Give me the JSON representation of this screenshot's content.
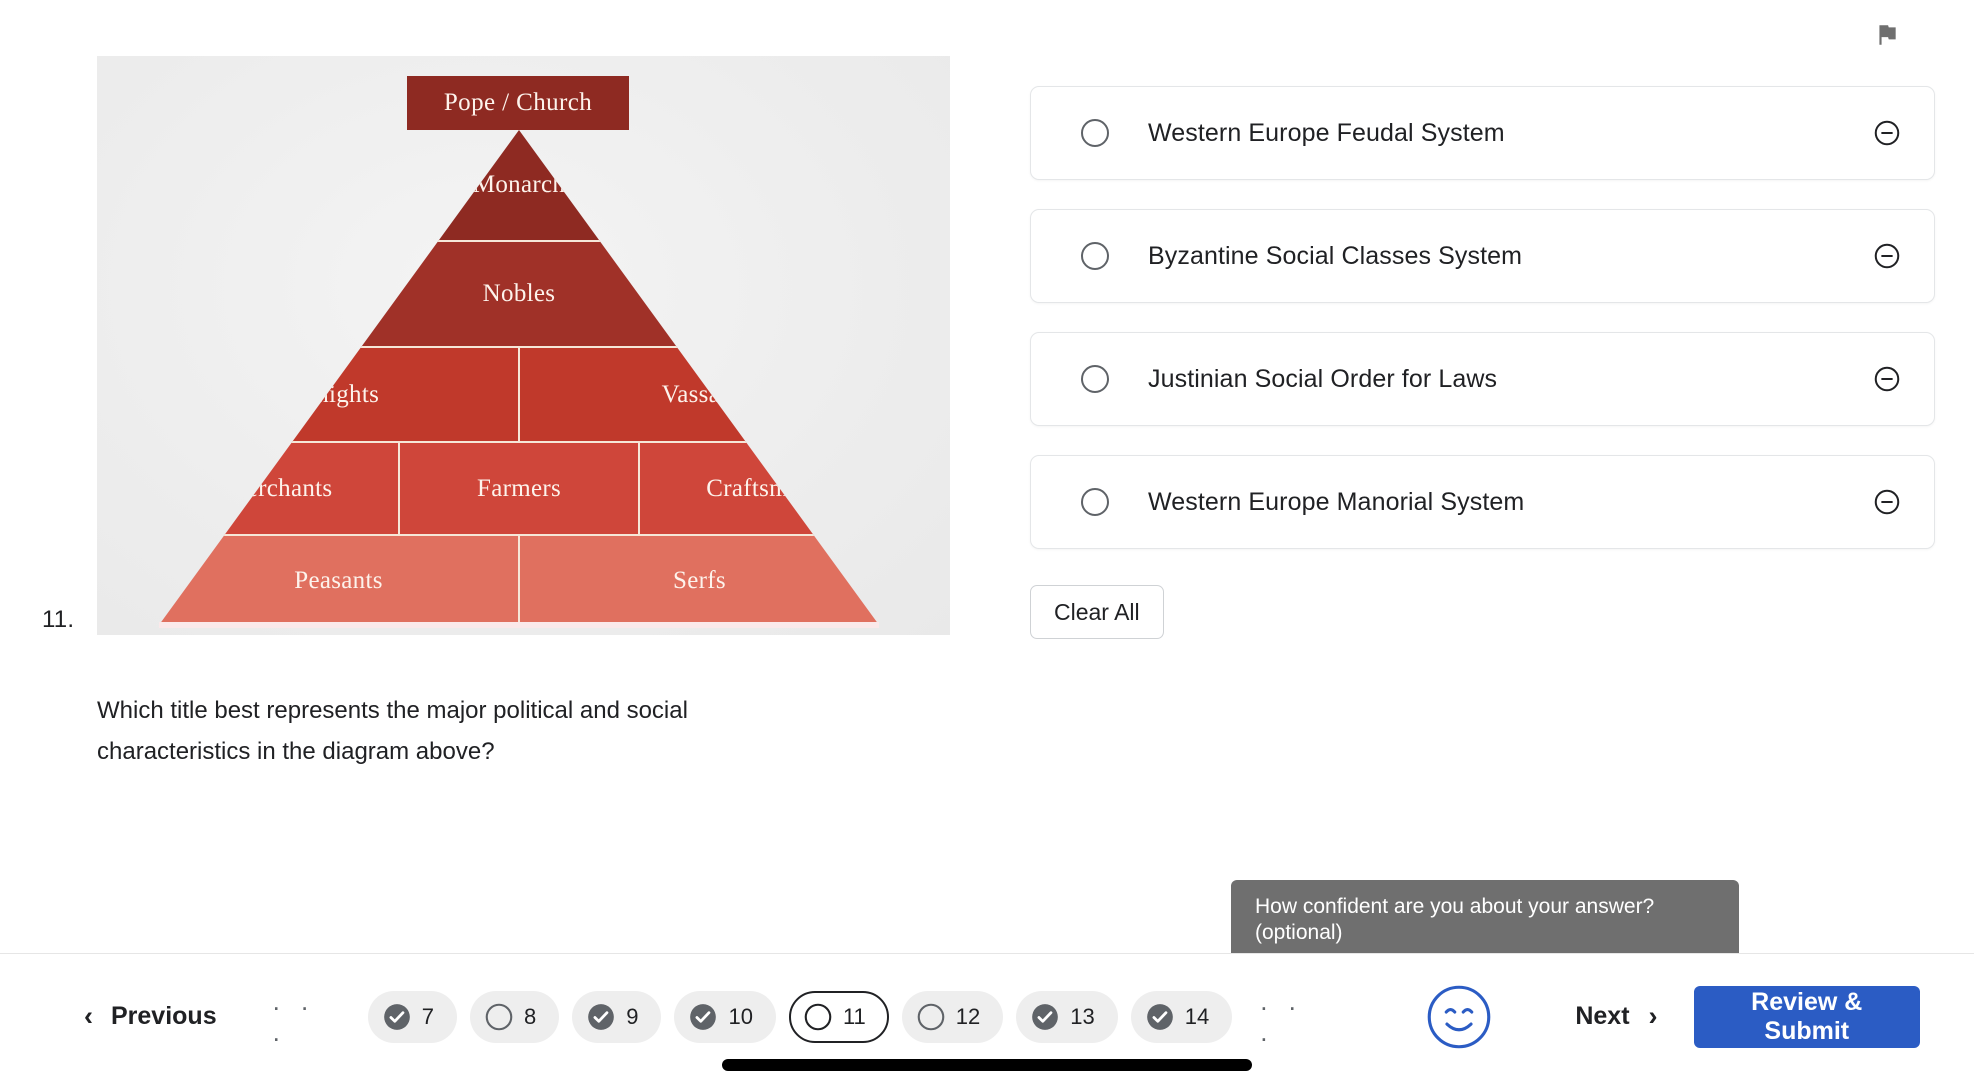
{
  "header": {
    "flag_icon": "flag-icon"
  },
  "question": {
    "number": "11.",
    "text": "Which title best represents the major political and social characteristics in the diagram above?"
  },
  "diagram": {
    "alt_name": "feudal-pyramid-diagram",
    "top_banner": "Pope / Church",
    "background_color": "#eeeeee",
    "rows": [
      {
        "cells": [
          "Monarch"
        ],
        "color": "#8e2a22"
      },
      {
        "cells": [
          "Nobles"
        ],
        "color": "#a03128"
      },
      {
        "cells": [
          "Knights",
          "Vassals"
        ],
        "color": "#c0392b"
      },
      {
        "cells": [
          "Merchants",
          "Farmers",
          "Craftsmen"
        ],
        "color": "#cf463a"
      },
      {
        "cells": [
          "Peasants",
          "Serfs"
        ],
        "color": "#e0705f"
      }
    ]
  },
  "options": {
    "items": [
      {
        "label": "Western Europe Feudal System",
        "selected": false,
        "eliminate_icon": "minus-circle-icon"
      },
      {
        "label": "Byzantine Social Classes System",
        "selected": false,
        "eliminate_icon": "minus-circle-icon"
      },
      {
        "label": "Justinian Social Order for Laws",
        "selected": false,
        "eliminate_icon": "minus-circle-icon"
      },
      {
        "label": "Western Europe Manorial System",
        "selected": false,
        "eliminate_icon": "minus-circle-icon"
      }
    ],
    "clear_all_label": "Clear All"
  },
  "tooltip": {
    "text": "How confident are you about your answer? (optional)"
  },
  "bottom_nav": {
    "previous_label": "Previous",
    "next_label": "Next",
    "submit_label": "Review & Submit",
    "ellipsis": ". . .",
    "confidence_icon": "smiley-face-icon",
    "pills": [
      {
        "number": "7",
        "state": "answered"
      },
      {
        "number": "8",
        "state": "unanswered"
      },
      {
        "number": "9",
        "state": "answered"
      },
      {
        "number": "10",
        "state": "answered"
      },
      {
        "number": "11",
        "state": "current"
      },
      {
        "number": "12",
        "state": "unanswered"
      },
      {
        "number": "13",
        "state": "answered"
      },
      {
        "number": "14",
        "state": "answered"
      }
    ]
  },
  "colors": {
    "accent_blue": "#2b5cc4",
    "tooltip_gray": "#6f6f6f",
    "pill_gray": "#eeeeee",
    "text": "#202124"
  }
}
